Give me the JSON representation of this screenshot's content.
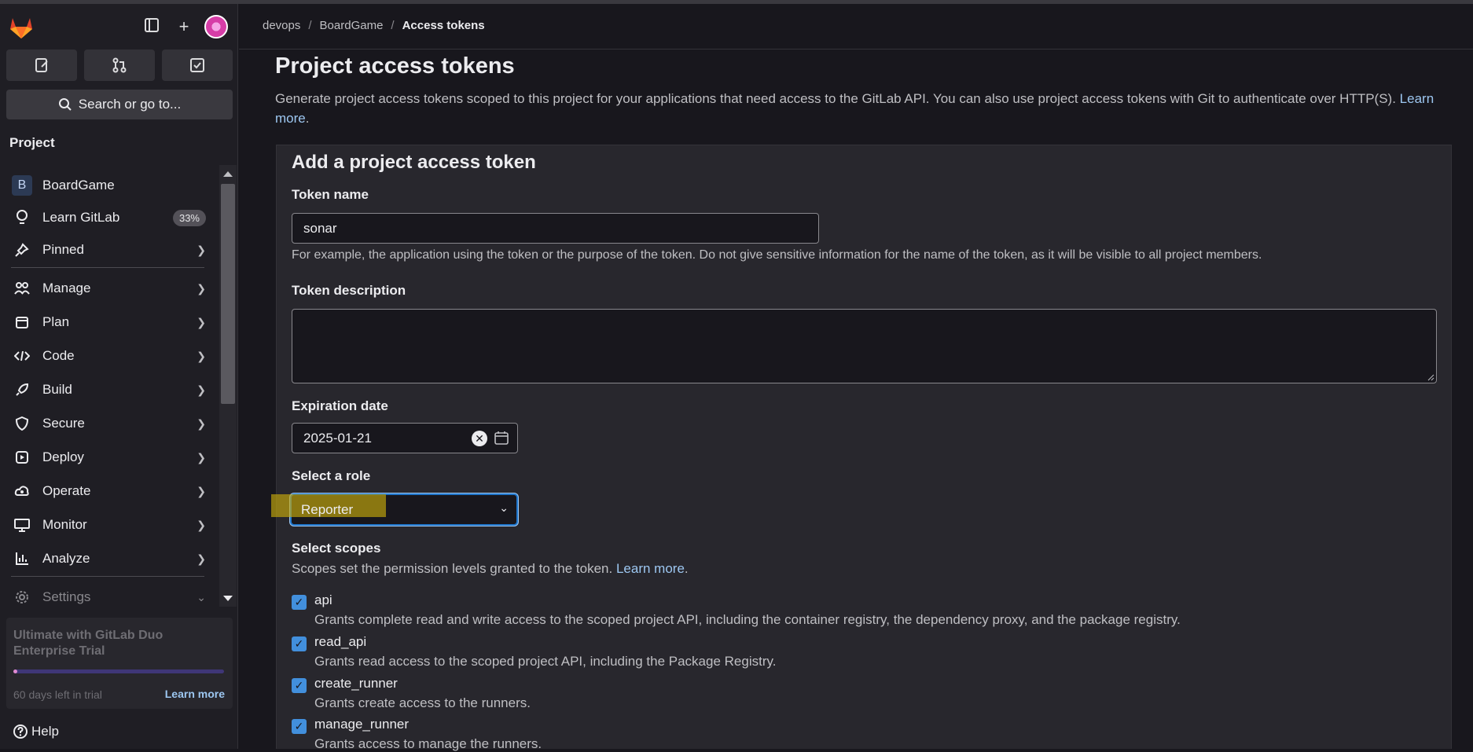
{
  "sidebar": {
    "heading": "Project",
    "search_label": "Search or go to...",
    "items": [
      {
        "label": "BoardGame",
        "badge": "B"
      },
      {
        "label": "Learn GitLab",
        "count": "33%"
      },
      {
        "label": "Pinned"
      },
      {
        "label": "Manage"
      },
      {
        "label": "Plan"
      },
      {
        "label": "Code"
      },
      {
        "label": "Build"
      },
      {
        "label": "Secure"
      },
      {
        "label": "Deploy"
      },
      {
        "label": "Operate"
      },
      {
        "label": "Monitor"
      },
      {
        "label": "Analyze"
      },
      {
        "label": "Settings"
      }
    ],
    "trial": {
      "title": "Ultimate with GitLab Duo Enterprise Trial",
      "progress": 0.02,
      "days_left": "60 days left in trial",
      "learn_more": "Learn more"
    },
    "help": "Help"
  },
  "breadcrumb": {
    "items": [
      "devops",
      "BoardGame",
      "Access tokens"
    ]
  },
  "page": {
    "title": "Project access tokens",
    "description": "Generate project access tokens scoped to this project for your applications that need access to the GitLab API. You can also use project access tokens with Git to authenticate over HTTP(S).",
    "learn_more": "Learn more"
  },
  "form": {
    "title": "Add a project access token",
    "token_name_label": "Token name",
    "token_name_value": "sonar",
    "token_name_hint": "For example, the application using the token or the purpose of the token. Do not give sensitive information for the name of the token, as it will be visible to all project members.",
    "description_label": "Token description",
    "description_value": "",
    "expiration_label": "Expiration date",
    "expiration_value": "2025-01-21",
    "role_label": "Select a role",
    "role_value": "Reporter",
    "scopes_label": "Select scopes",
    "scopes_hint": "Scopes set the permission levels granted to the token.",
    "scopes_learn_more": "Learn more",
    "scopes": [
      {
        "name": "api",
        "checked": true,
        "desc": "Grants complete read and write access to the scoped project API, including the container registry, the dependency proxy, and the package registry."
      },
      {
        "name": "read_api",
        "checked": true,
        "desc": "Grants read access to the scoped project API, including the Package Registry."
      },
      {
        "name": "create_runner",
        "checked": true,
        "desc": "Grants create access to the runners."
      },
      {
        "name": "manage_runner",
        "checked": true,
        "desc": "Grants access to manage the runners."
      }
    ]
  },
  "colors": {
    "accent": "#1f75cb",
    "link": "#9dc7f1",
    "checkbox": "#428fdc",
    "highlight": "#c8aa0a"
  }
}
